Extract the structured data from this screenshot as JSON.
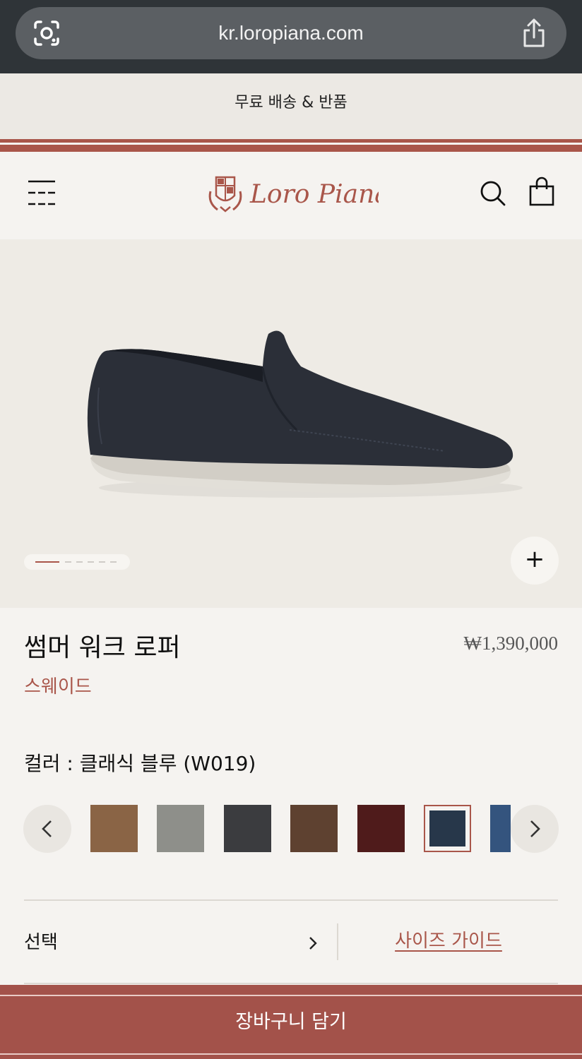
{
  "browser": {
    "url": "kr.loropiana.com"
  },
  "promo": {
    "text": "무료 배송 & 반품"
  },
  "header": {
    "brand": "Loro Piana"
  },
  "product": {
    "title": "썸머 워크 로퍼",
    "material": "스웨이드",
    "price": "₩1,390,000",
    "color_label": "컬러 : 클래식 블루 (W019)",
    "gallery": {
      "current_image": 1,
      "total_images": 6
    }
  },
  "swatches": [
    {
      "name": "tan",
      "color": "#8a6445"
    },
    {
      "name": "grey",
      "color": "#8e8f8a"
    },
    {
      "name": "charcoal",
      "color": "#3b3c3f"
    },
    {
      "name": "brown",
      "color": "#5e4130"
    },
    {
      "name": "burgundy",
      "color": "#4f1b1b"
    },
    {
      "name": "classic-blue",
      "color": "#27374a",
      "selected": true
    },
    {
      "name": "denim-blue",
      "color": "#34547e"
    }
  ],
  "size": {
    "select_label": "선택",
    "guide_label": "사이즈 가이드"
  },
  "cart": {
    "label": "장바구니 담기"
  },
  "colors": {
    "accent": "#a9564a",
    "background": "#f5f3f0"
  }
}
